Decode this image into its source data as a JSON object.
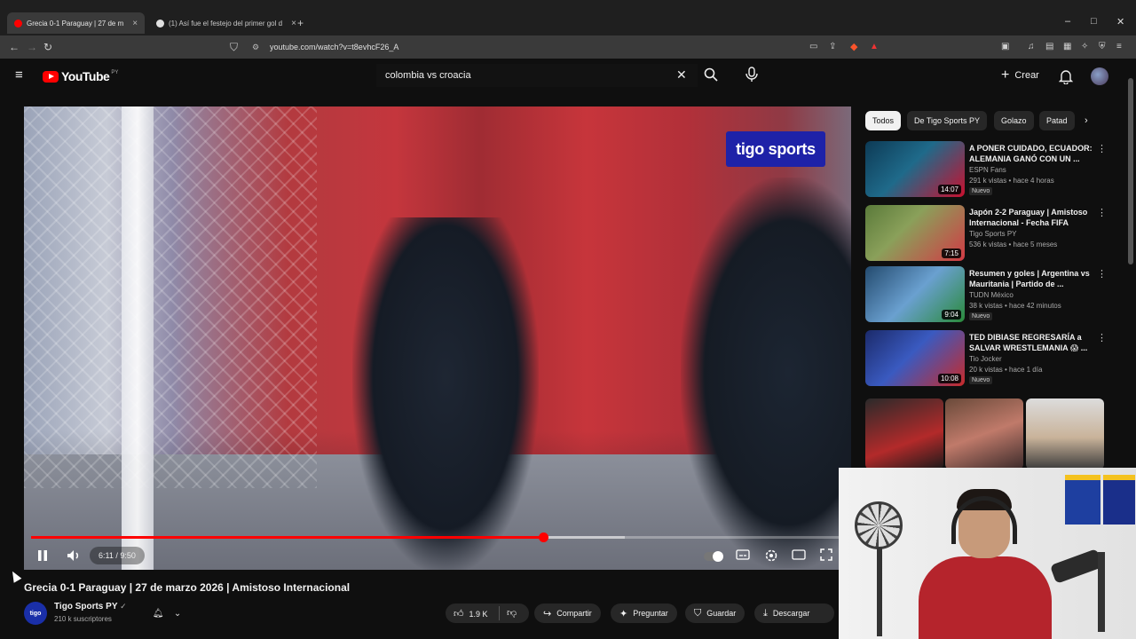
{
  "browser": {
    "tabs": [
      {
        "title": "Grecia 0-1 Paraguay | 27 de m",
        "active": true,
        "favicon_color": "#ff0000"
      },
      {
        "title": "(1) Así fue el festejo del primer gol d",
        "active": false,
        "favicon_color": "#e0e0e0"
      }
    ],
    "new_tab": "+",
    "tab_close": "×",
    "url": "youtube.com/watch?v=t8evhcF26_A",
    "window_controls": [
      "–",
      "□",
      "✕"
    ]
  },
  "youtube": {
    "logo_text": "YouTube",
    "country_code": "PY",
    "search_value": "colombia vs croacia",
    "clear_label": "✕",
    "create_label": "Crear",
    "create_plus": "+"
  },
  "player": {
    "watermark": "tigo sports",
    "time_current": "6:11",
    "time_total": "9:50",
    "time_separator": " / ",
    "progress_fraction": 0.63,
    "buffer_fraction": 0.73
  },
  "video": {
    "title": "Grecia 0-1 Paraguay | 27 de marzo 2026 | Amistoso Internacional",
    "channel_name": "Tigo Sports PY",
    "channel_avatar_text": "tigo",
    "channel_subs": "210 k suscriptores",
    "likes": "1.9 K",
    "actions": {
      "share": "Compartir",
      "ask": "Preguntar",
      "save": "Guardar",
      "download": "Descargar"
    }
  },
  "sidebar": {
    "chips": [
      "Todos",
      "De Tigo Sports PY",
      "Golazo",
      "Patad"
    ],
    "recommendations": [
      {
        "title": "A PONER CUIDADO, ECUADOR: ALEMANIA GANÓ CON UN ...",
        "channel": "ESPN Fans",
        "meta": "291 k vistas • hace 4 horas",
        "badge": "Nuevo",
        "duration": "14:07",
        "thumb_colors": [
          "#0d3a55",
          "#c8102e"
        ]
      },
      {
        "title": "Japón 2-2 Paraguay | Amistoso Internacional - Fecha FIFA",
        "channel": "Tigo Sports PY",
        "meta": "536 k vistas • hace 5 meses",
        "badge": "",
        "duration": "7:15",
        "thumb_colors": [
          "#5a7a3a",
          "#d23a45"
        ]
      },
      {
        "title": "Resumen y goles | Argentina vs Mauritania | Partido de ...",
        "channel": "TUDN México",
        "meta": "38 k vistas • hace 42 minutos",
        "badge": "Nuevo",
        "duration": "9:04",
        "thumb_colors": [
          "#234a6e",
          "#2a8a3a"
        ]
      },
      {
        "title": "TED DIBIASE REGRESARÍA a SALVAR WRESTLEMANIA 😱 ...",
        "channel": "Tio Jocker",
        "meta": "20 k vistas • hace 1 día",
        "badge": "Nuevo",
        "duration": "10:08",
        "thumb_colors": [
          "#1b2a6a",
          "#c82a2a"
        ]
      }
    ]
  }
}
